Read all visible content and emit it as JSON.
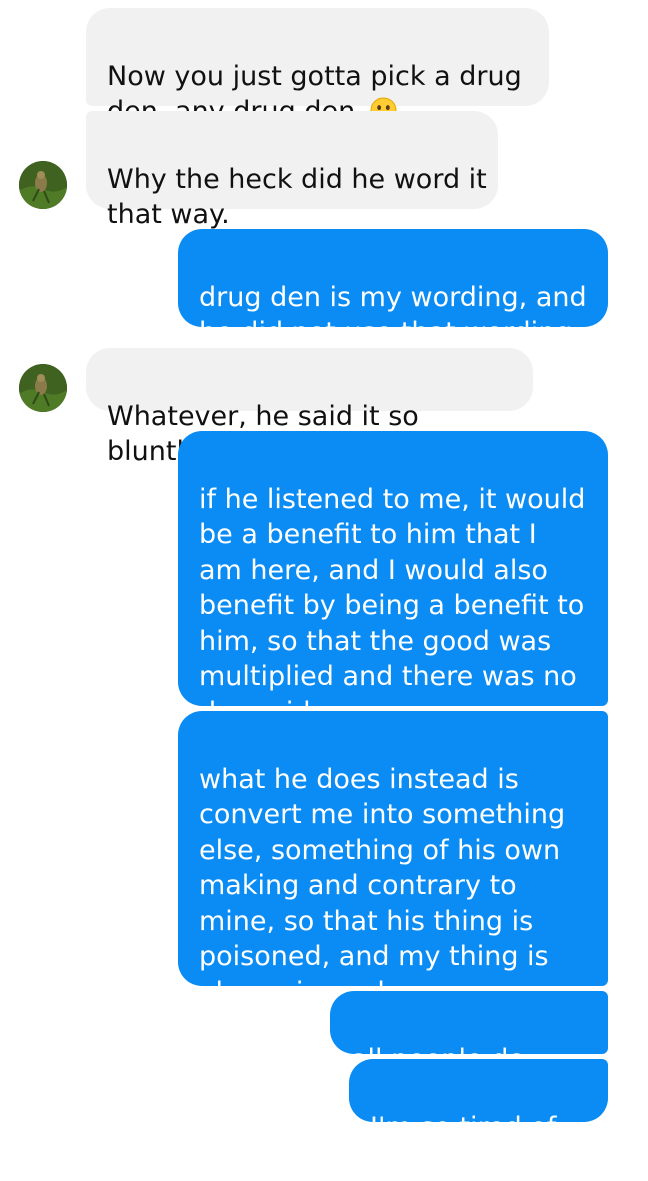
{
  "colors": {
    "incoming_bubble": "#f1f1f1",
    "outgoing_bubble": "#0a8cf4",
    "incoming_text": "#111111",
    "outgoing_text": "#ffffff"
  },
  "contact": {
    "avatar_icon": "avatar-photo-icon"
  },
  "messages": [
    {
      "sender": "them",
      "text": "Now you just gotta pick a drug den, any drug den.",
      "emoji": "confused-face-icon"
    },
    {
      "sender": "them",
      "text": "Why the heck did he word it that way."
    },
    {
      "sender": "me",
      "text": "drug den is my wording, and he did not use that wording"
    },
    {
      "sender": "them",
      "text": "Whatever, he said it so bluntly."
    },
    {
      "sender": "me",
      "text": "if he listened to me, it would be a benefit to him that I am here, and I would also benefit by being a benefit to him, so that the good was multiplied and there was no downside."
    },
    {
      "sender": "me",
      "text": "what he does instead is convert me into something else, something of his own making and contrary to mine, so that his thing is poisoned, and my thing is also poisoned."
    },
    {
      "sender": "me",
      "text": "all people do this."
    },
    {
      "sender": "me",
      "text": "I'm so tired of it."
    }
  ]
}
